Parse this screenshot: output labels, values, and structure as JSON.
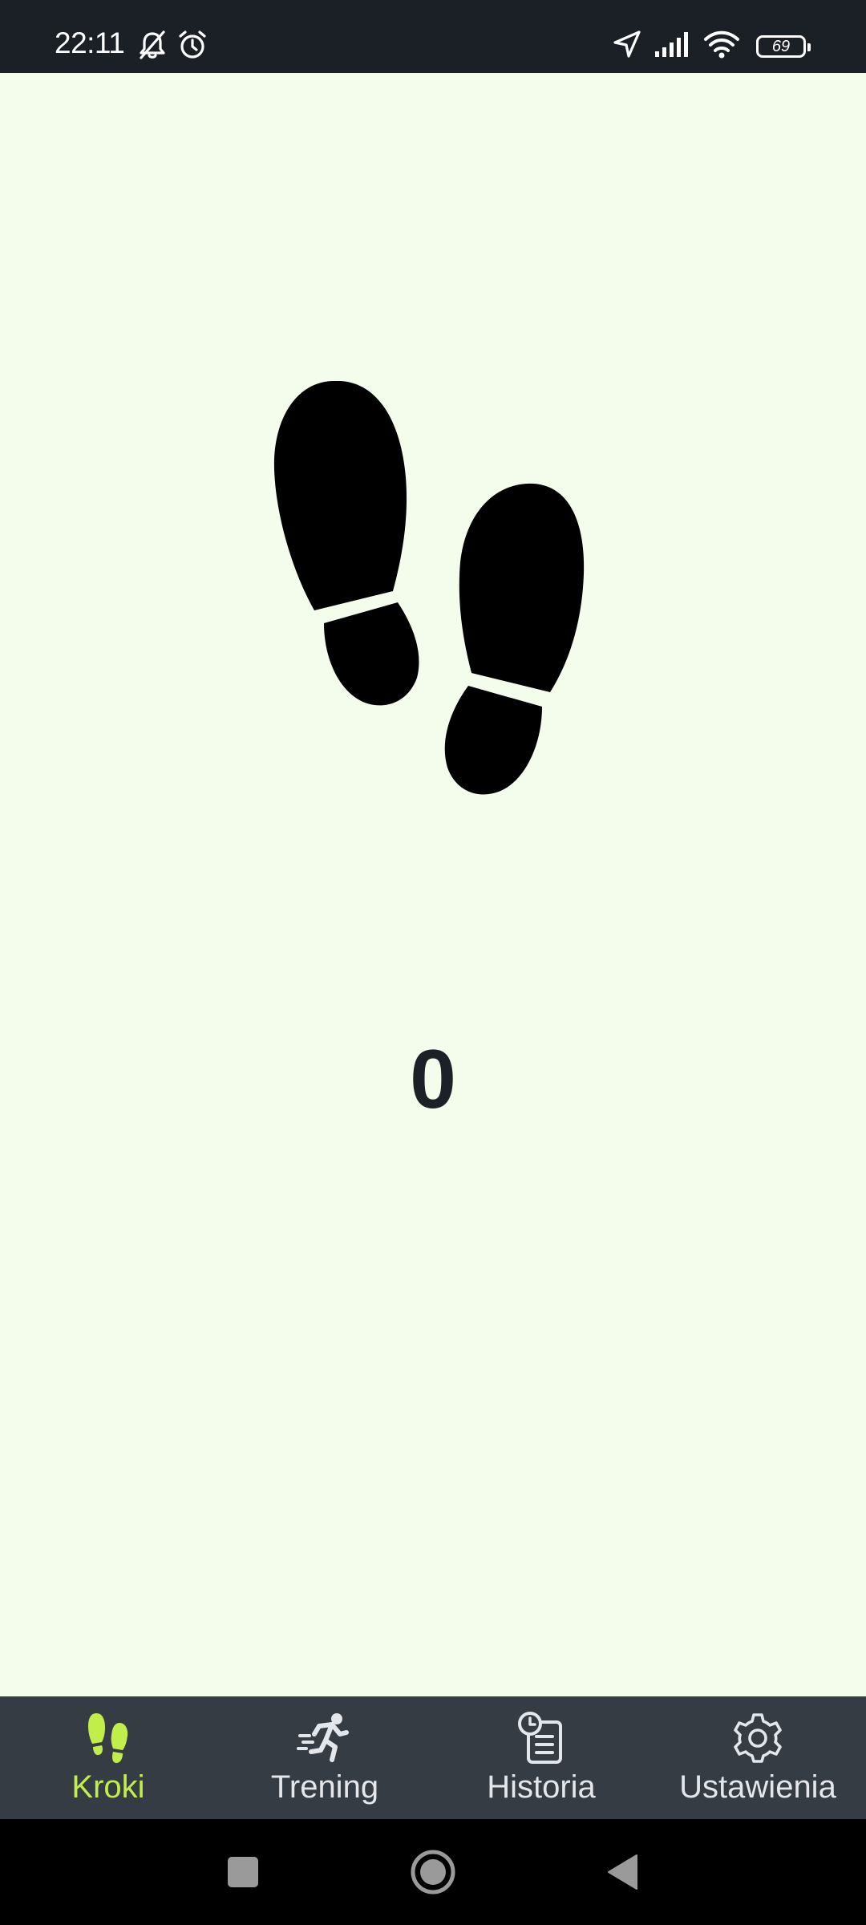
{
  "status_bar": {
    "time": "22:11",
    "battery_level": "69",
    "left_icons": [
      "bell-off-icon",
      "alarm-icon"
    ],
    "right_icons": [
      "location-arrow-icon",
      "signal-icon",
      "wifi-icon",
      "battery-icon"
    ]
  },
  "main": {
    "hero_icon": "footprints-icon",
    "step_count": "0"
  },
  "bottom_nav": {
    "active_color": "#c2ee4a",
    "items": [
      {
        "label": "Kroki",
        "icon": "footprints-icon",
        "active": true
      },
      {
        "label": "Trening",
        "icon": "running-icon",
        "active": false
      },
      {
        "label": "Historia",
        "icon": "history-icon",
        "active": false
      },
      {
        "label": "Ustawienia",
        "icon": "gear-icon",
        "active": false
      }
    ]
  },
  "system_nav": {
    "buttons": [
      "recents-button",
      "home-button",
      "back-button"
    ]
  }
}
